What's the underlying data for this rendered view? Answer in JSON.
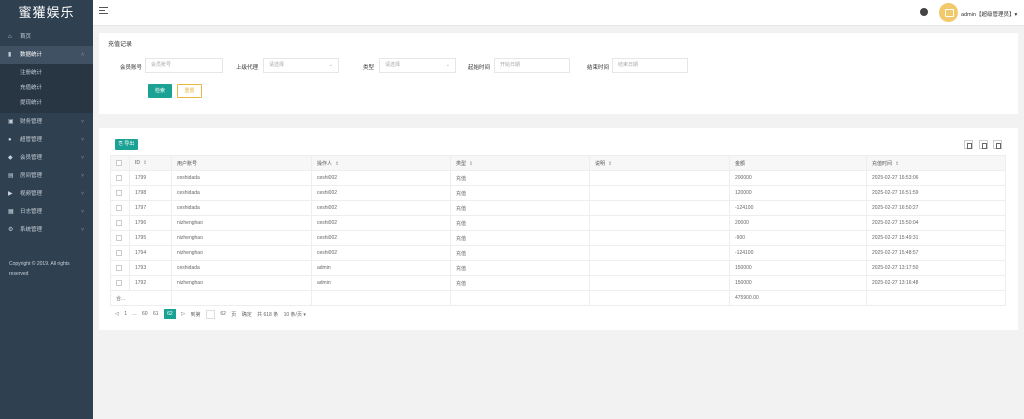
{
  "app": {
    "logo": "蜜獾娱乐"
  },
  "sidebar": {
    "items": [
      {
        "label": "首页",
        "icon": "home-icon"
      },
      {
        "label": "数据统计",
        "icon": "bar-chart-icon",
        "arrow": "˄"
      },
      {
        "label": "财务管理",
        "icon": "wallet-icon",
        "arrow": "˅"
      },
      {
        "label": "超管管理",
        "icon": "user-icon",
        "arrow": "˅"
      },
      {
        "label": "会员管理",
        "icon": "users-icon",
        "arrow": "˅"
      },
      {
        "label": "房间管理",
        "icon": "room-icon",
        "arrow": "˅"
      },
      {
        "label": "视频管理",
        "icon": "video-icon",
        "arrow": "˅"
      },
      {
        "label": "日志管理",
        "icon": "log-icon",
        "arrow": "˅"
      },
      {
        "label": "系统管理",
        "icon": "settings-icon",
        "arrow": "˅"
      }
    ],
    "sub_items": [
      "注册统计",
      "充值统计",
      "提现统计"
    ],
    "copyright_line1": "Copyright © 2019. All rights",
    "copyright_line2": "reserved"
  },
  "header": {
    "user": "admin【超级管理员】▾"
  },
  "search": {
    "title": "充值记录",
    "account_label": "会员账号",
    "account_placeholder": "会员账号",
    "agent_label": "上级代理",
    "agent_value": "请选择",
    "type_label": "类型",
    "type_value": "请选择",
    "start_label": "起始时间",
    "start_placeholder": "开始日期",
    "end_label": "结束时间",
    "end_placeholder": "结束日期",
    "search_btn": "检索",
    "reset_btn": "重置",
    "caret": "⌄"
  },
  "table": {
    "export_btn": "导出",
    "headers": {
      "id": "ID",
      "account": "用户账号",
      "operator": "操作人",
      "type": "类型",
      "note": "说明",
      "amount": "金额",
      "time": "充值时间",
      "sort": "⇕"
    },
    "rows": [
      {
        "id": "1799",
        "account": "ceshidada",
        "operator": "ceshi002",
        "type": "充值",
        "note": "",
        "amount": "200000",
        "time": "2025-02-27 16:53:06"
      },
      {
        "id": "1798",
        "account": "ceshidada",
        "operator": "ceshi002",
        "type": "充值",
        "note": "",
        "amount": "120000",
        "time": "2025-02-27 16:51:59"
      },
      {
        "id": "1797",
        "account": "ceshidada",
        "operator": "ceshi002",
        "type": "充值",
        "note": "",
        "amount": "-124100",
        "time": "2025-02-27 16:50:27"
      },
      {
        "id": "1796",
        "account": "nizhenghao",
        "operator": "ceshi002",
        "type": "充值",
        "note": "",
        "amount": "20000",
        "time": "2025-02-27 15:50:04"
      },
      {
        "id": "1795",
        "account": "nizhenghao",
        "operator": "ceshi002",
        "type": "充值",
        "note": "",
        "amount": "-900",
        "time": "2025-02-27 15:49:31"
      },
      {
        "id": "1794",
        "account": "nizhenghao",
        "operator": "ceshi002",
        "type": "充值",
        "note": "",
        "amount": "-124100",
        "time": "2025-02-27 15:48:57"
      },
      {
        "id": "1793",
        "account": "ceshidada",
        "operator": "admin",
        "type": "充值",
        "note": "",
        "amount": "150000",
        "time": "2025-02-27 13:17:50"
      },
      {
        "id": "1792",
        "account": "nizhenghao",
        "operator": "admin",
        "type": "充值",
        "note": "",
        "amount": "150000",
        "time": "2025-02-27 13:16:48"
      }
    ],
    "summary_label": "合...",
    "summary_amount": "475900.00"
  },
  "pager": {
    "items": [
      "1",
      "...",
      "60",
      "61",
      "62"
    ],
    "current": "62",
    "goto_label": "到第",
    "goto_value": "62",
    "page_unit": "页",
    "confirm": "确定",
    "total": "共 618 条",
    "per_page": "10 条/页 ▾"
  },
  "colors": {
    "sidebar": "#2f4050",
    "accent": "#1aa394",
    "warning": "#e6b843"
  }
}
